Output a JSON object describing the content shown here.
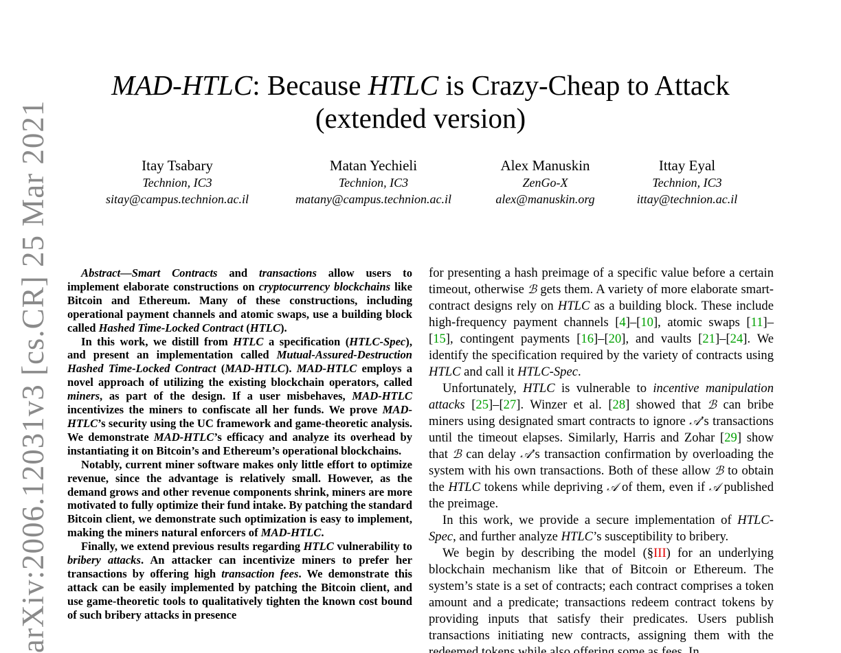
{
  "paper": {
    "title_line1_a": "MAD-HTLC",
    "title_line1_b": ": Because ",
    "title_line1_c": "HTLC",
    "title_line1_d": " is Crazy-Cheap to Attack",
    "title_line2": "(extended version)",
    "authors": [
      {
        "name": "Itay Tsabary",
        "affiliation": "Technion, IC3",
        "email": "sitay@campus.technion.ac.il"
      },
      {
        "name": "Matan Yechieli",
        "affiliation": "Technion, IC3",
        "email": "matany@campus.technion.ac.il"
      },
      {
        "name": "Alex Manuskin",
        "affiliation": "ZenGo-X",
        "email": "alex@manuskin.org"
      },
      {
        "name": "Ittay Eyal",
        "affiliation": "Technion, IC3",
        "email": "ittay@technion.ac.il"
      }
    ],
    "arxiv_stamp": "arXiv:2006.12031v3  [cs.CR]  25 Mar 2021"
  },
  "abstract": {
    "p1": [
      "Abstract—Smart Contracts",
      " and ",
      "transactions",
      " allow users to implement elaborate constructions on ",
      "cryptocurrency blockchains",
      " like Bitcoin and Ethereum. Many of these constructions, in­cluding operational payment channels and atomic swaps, use a building block called ",
      "Hashed Time-Locked Contract",
      " (",
      "HTLC",
      ")."
    ],
    "p2": [
      "In this work, we distill from ",
      "HTLC",
      " a specification (",
      "HTLC-Spec",
      "), and present an implementation called ",
      "Mutual-Assured-Destruction Hashed Time-Locked Contract",
      " (",
      "MAD-HTLC",
      "). ",
      "MAD-HTLC",
      " employs a novel approach of utilizing the existing blockchain operators, called ",
      "miners",
      ", as part of the design. If a user misbehaves, ",
      "MAD-HTLC",
      " incentivizes the miners to confiscate all her funds. We prove ",
      "MAD-HTLC",
      "’s security using the UC framework and game-theoretic analysis. We demonstrate ",
      "MAD-HTLC",
      "’s efficacy and analyze its overhead by instantiating it on Bitcoin’s and Ethereum’s operational blockchains."
    ],
    "p3": [
      "Notably, current miner software makes only little effort to optimize revenue, since the advantage is relatively small. How­ever, as the demand grows and other revenue components shrink, miners are more motivated to fully optimize their fund intake. By patching the standard Bitcoin client, we demonstrate such optimization is easy to implement, making the miners natural enforcers of ",
      "MAD-HTLC",
      "."
    ],
    "p4": [
      "Finally, we extend previous results regarding ",
      "HTLC",
      " vulnera­bility to ",
      "bribery attacks",
      ". An attacker can incentivize miners to prefer her transactions by offering high ",
      "transaction fees",
      ". We demonstrate this attack can be easily implemented by patching the Bitcoin client, and use game-theoretic tools to qualitatively tighten the known cost bound of such bribery attacks in presence"
    ]
  },
  "body": {
    "p1": [
      "for presenting a hash preimage of a specific value before a certain timeout, otherwise ",
      "ℬ",
      " gets them. A variety of more elaborate smart-contract designs rely on ",
      "HTLC",
      " as a building block. These include high-frequency payment channels [",
      "4",
      "]–[",
      "10",
      "], atomic swaps [",
      "11",
      "]–[",
      "15",
      "], contingent payments [",
      "16",
      "]–[",
      "20",
      "], and vaults [",
      "21",
      "]–[",
      "24",
      "]. We identify the specification required by the variety of contracts using ",
      "HTLC",
      " and call it ",
      "HTLC-Spec",
      "."
    ],
    "p2": [
      "Unfortunately, ",
      "HTLC",
      " is vulnerable to ",
      "incentive manipula­tion attacks",
      " [",
      "25",
      "]–[",
      "27",
      "]. Winzer et al. [",
      "28",
      "] showed that ",
      "ℬ",
      " can bribe miners using designated smart contracts to ignore ",
      "𝒜",
      "’s transactions until the timeout elapses. Similarly, Harris and Zohar [",
      "29",
      "] show that ",
      "ℬ",
      " can delay ",
      "𝒜",
      "’s transaction confirmation by overloading the system with his own transactions. Both of these allow ",
      "ℬ",
      " to obtain the ",
      "HTLC",
      " tokens while depriving ",
      "𝒜",
      " of them, even if ",
      "𝒜",
      " published the preimage."
    ],
    "p3": [
      "In this work, we provide a secure implementation of ",
      "HTLC-Spec",
      ", and further analyze ",
      "HTLC",
      "’s susceptibility to bribery."
    ],
    "p4": [
      "We begin by describing the model (§",
      "III",
      ") for an underlying blockchain mechanism like that of Bitcoin or Ethereum. The system’s state is a set of contracts; each contract comprises a token amount and a predicate; transactions redeem contract tokens by providing inputs that satisfy their predicates. Users publish transactions initiating new contracts, assigning them with the redeemed tokens while also offering some as fees. In"
    ]
  },
  "colors": {
    "citation": "#00a000",
    "section_ref": "#e00000",
    "stamp": "#8a8a8a"
  }
}
